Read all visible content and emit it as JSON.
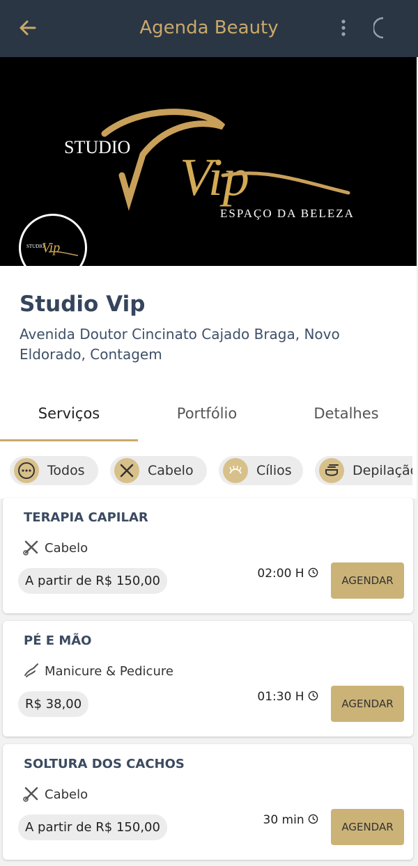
{
  "app_bar": {
    "title": "Agenda Beauty"
  },
  "banner": {
    "logo_word": "STUDIO",
    "logo_script": "Vip",
    "logo_tagline": "ESPAÇO DA BELEZA"
  },
  "studio": {
    "name": "Studio Vip",
    "address": "Avenida Doutor Cincinato Cajado Braga, Novo Eldorado, Contagem"
  },
  "tabs": [
    "Serviços",
    "Portfólio",
    "Detalhes"
  ],
  "active_tab": "Serviços",
  "categories": [
    "Todos",
    "Cabelo",
    "Cílios",
    "Depilação"
  ],
  "services": [
    {
      "title": "TERAPIA CAPILAR",
      "category": "Cabelo",
      "price": "A partir de R$ 150,00",
      "duration": "02:00 H",
      "button": "AGENDAR"
    },
    {
      "title": "PÉ E MÃO",
      "category": "Manicure & Pedicure",
      "price": "R$ 38,00",
      "duration": "01:30 H",
      "button": "AGENDAR"
    },
    {
      "title": "SOLTURA DOS CACHOS",
      "category": "Cabelo",
      "price": "A partir de R$ 150,00",
      "duration": "30 min",
      "button": "AGENDAR"
    }
  ],
  "colors": {
    "app_bar": "#2b3644",
    "accent_gold": "#c9a96a",
    "button": "#cbb277",
    "title_text": "#35455c"
  },
  "icons": {
    "back": "arrow-left-icon",
    "menu": "more-vert-icon",
    "theme": "moon-icon",
    "clock": "clock-icon"
  }
}
